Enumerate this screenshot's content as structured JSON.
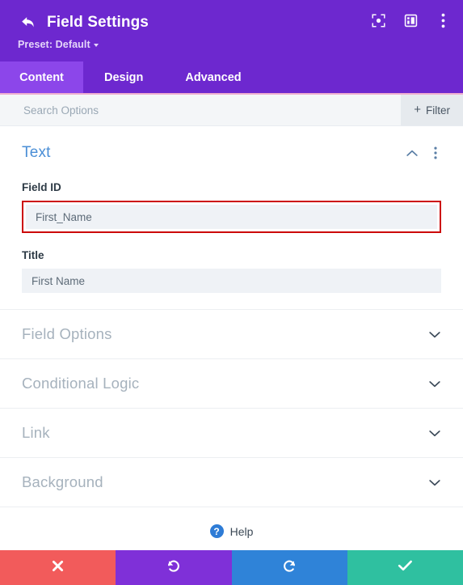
{
  "header": {
    "title": "Field Settings",
    "back_icon": "back-arrow-icon",
    "preset_label": "Preset: Default",
    "icons": [
      {
        "name": "focus-frame-icon"
      },
      {
        "name": "layout-columns-icon"
      },
      {
        "name": "vertical-dots-icon"
      }
    ]
  },
  "tabs": [
    {
      "label": "Content",
      "active": true
    },
    {
      "label": "Design",
      "active": false
    },
    {
      "label": "Advanced",
      "active": false
    }
  ],
  "search": {
    "placeholder": "Search Options",
    "value": "",
    "filter_label": "Filter",
    "filter_plus": "+"
  },
  "section": {
    "title": "Text",
    "collapse_icon": "chevron-up-icon",
    "menu_icon": "vertical-dots-icon",
    "fields": [
      {
        "label": "Field ID",
        "value": "First_Name",
        "highlighted": true,
        "name": "field-id"
      },
      {
        "label": "Title",
        "value": "First Name",
        "highlighted": false,
        "name": "title"
      }
    ]
  },
  "accordions": [
    {
      "label": "Field Options",
      "icon": "chevron-down-icon"
    },
    {
      "label": "Conditional Logic",
      "icon": "chevron-down-icon"
    },
    {
      "label": "Link",
      "icon": "chevron-down-icon"
    },
    {
      "label": "Background",
      "icon": "chevron-down-icon"
    }
  ],
  "help": {
    "label": "Help",
    "icon": "question-mark-icon"
  },
  "footer": {
    "buttons": [
      {
        "name": "cancel-button",
        "icon": "close-x-icon",
        "color": "#f25b5b"
      },
      {
        "name": "undo-button",
        "icon": "undo-arrow-icon",
        "color": "#7f30d8"
      },
      {
        "name": "redo-button",
        "icon": "redo-arrow-icon",
        "color": "#2f83d8"
      },
      {
        "name": "save-button",
        "icon": "checkmark-icon",
        "color": "#2fc0a0"
      }
    ]
  },
  "colors": {
    "header_purple": "#6d28cf",
    "active_tab_purple": "#8c46ea",
    "tab_underline_pink": "#efaed0",
    "section_title_blue": "#4a8ed6",
    "highlight_red": "#cc0a0a",
    "input_bg": "#eff2f6",
    "muted_gray": "#a6b2bd"
  }
}
